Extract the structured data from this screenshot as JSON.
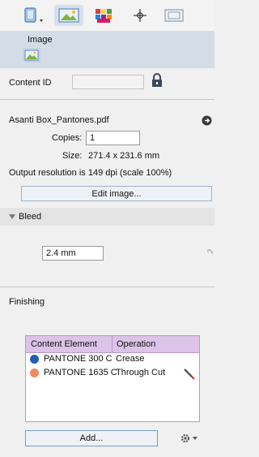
{
  "toolbar": {
    "buttons": [
      {
        "icon": "document-properties-icon",
        "active": false
      },
      {
        "icon": "image-icon",
        "active": true
      },
      {
        "icon": "color-swatches-icon",
        "active": false
      },
      {
        "icon": "registration-mark-icon",
        "active": false
      },
      {
        "icon": "page-frame-icon",
        "active": false
      }
    ]
  },
  "tab": {
    "label": "Image",
    "icon": "image-icon"
  },
  "content_id": {
    "label": "Content ID",
    "value": "",
    "lock_icon": "lock-icon"
  },
  "file": {
    "name": "Asanti Box_Pantones.pdf",
    "copies_label": "Copies:",
    "copies_value": "1",
    "size_label": "Size:",
    "size_value": "271.4 x 231.6 mm",
    "resolution": "Output resolution is 149 dpi (scale 100%)",
    "edit_button": "Edit image..."
  },
  "bleed": {
    "label": "Bleed",
    "value": "2.4 mm"
  },
  "finishing": {
    "label": "Finishing",
    "columns": [
      "Content Element",
      "Operation"
    ],
    "rows": [
      {
        "element": "PANTONE 300 C",
        "operation": "Crease",
        "color": "#1f5fae",
        "has_knife": false
      },
      {
        "element": "PANTONE 1635 C",
        "operation": "Through Cut",
        "color": "#f08a63",
        "has_knife": true
      }
    ],
    "add_button": "Add...",
    "settings_icon": "gear-icon"
  },
  "colors": {
    "accent_header": "#dcc3e8",
    "tab_bg": "#d4dde6"
  }
}
